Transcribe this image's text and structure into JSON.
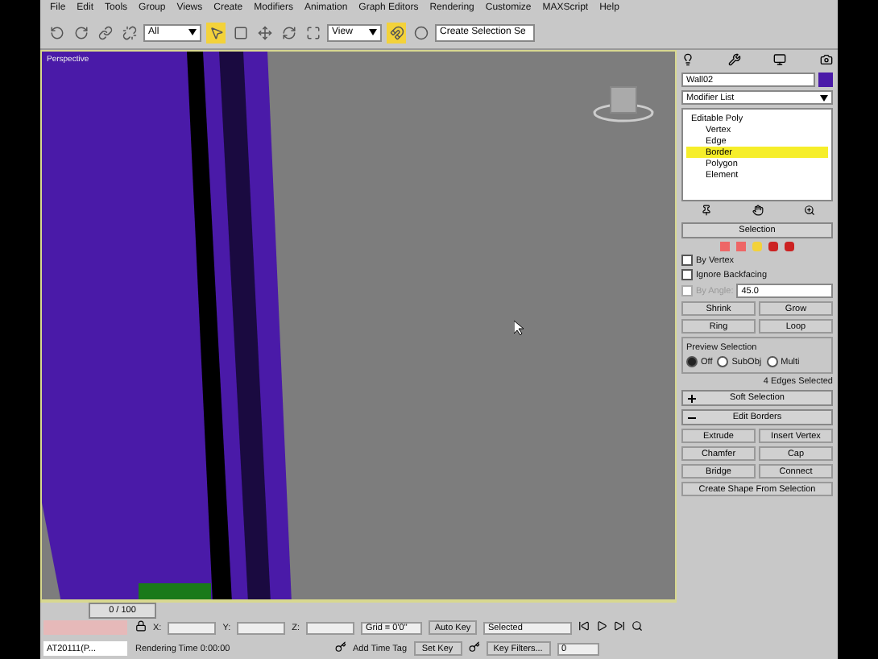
{
  "menu": [
    "File",
    "Edit",
    "Tools",
    "Group",
    "Views",
    "Create",
    "Modifiers",
    "Animation",
    "Graph Editors",
    "Rendering",
    "Customize",
    "MAXScript",
    "Help"
  ],
  "toolbar": {
    "filter": "All",
    "coord": "View",
    "selection_set": "Create Selection Se"
  },
  "viewport": {
    "label": "Perspective"
  },
  "panel": {
    "object_name": "Wall02",
    "modifier_list": "Modifier List",
    "stack": [
      {
        "label": "Editable Poly",
        "selected": false,
        "children": [
          {
            "label": "Vertex",
            "selected": false
          },
          {
            "label": "Edge",
            "selected": false
          },
          {
            "label": "Border",
            "selected": true
          },
          {
            "label": "Polygon",
            "selected": false
          },
          {
            "label": "Element",
            "selected": false
          }
        ]
      }
    ],
    "selection": {
      "title": "Selection",
      "checks": [
        {
          "label": "By Vertex",
          "checked": false,
          "disabled": false
        },
        {
          "label": "Ignore Backfacing",
          "checked": false,
          "disabled": false
        },
        {
          "label": "By Angle:",
          "checked": false,
          "disabled": true,
          "value": "45.0"
        }
      ],
      "buttons": [
        [
          "Shrink",
          "Grow"
        ],
        [
          "Ring",
          "Loop"
        ]
      ],
      "preview_title": "Preview Selection",
      "preview": [
        {
          "label": "Off",
          "selected": true
        },
        {
          "label": "SubObj",
          "selected": false
        },
        {
          "label": "Multi",
          "selected": false
        }
      ],
      "status": "4 Edges Selected"
    },
    "rollouts": [
      {
        "label": "Soft Selection",
        "expanded": false
      },
      {
        "label": "Edit Borders",
        "expanded": true
      }
    ],
    "border_buttons": [
      [
        "Extrude",
        "Insert Vertex"
      ],
      [
        "Chamfer",
        "Cap"
      ],
      [
        "Bridge",
        "Connect"
      ]
    ],
    "wide_button": "Create Shape From Selection"
  },
  "time_slider": {
    "label": "0 / 100"
  },
  "status": {
    "script_line": "AT20111(P...",
    "x_label": "X:",
    "y_label": "Y:",
    "z_label": "Z:",
    "grid": "Grid = 0'0\"",
    "prompt": "Rendering Time  0:00:00",
    "time_tag": "Add Time Tag",
    "auto_key": "Auto Key",
    "key_mode": "Selected",
    "set_key": "Set Key",
    "key_filters": "Key Filters...",
    "frame": "0"
  }
}
